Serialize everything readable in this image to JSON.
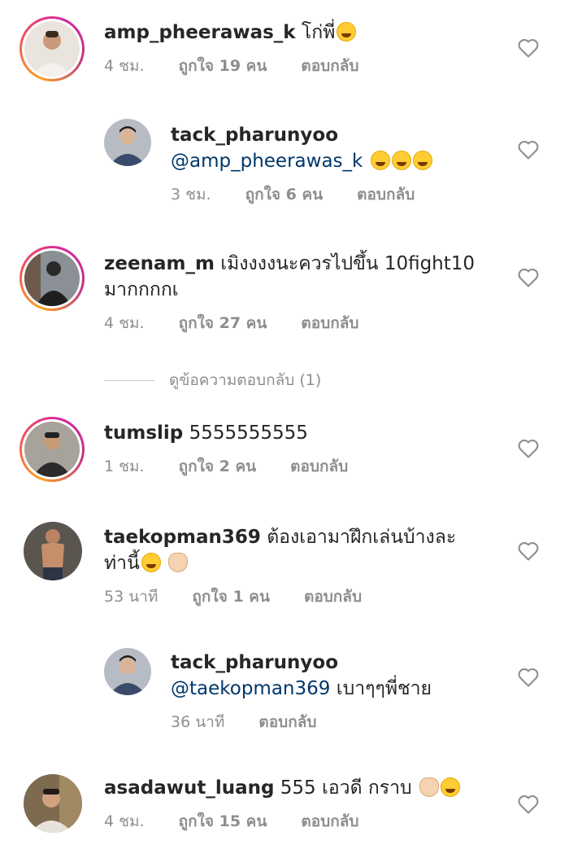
{
  "comments": [
    {
      "username": "amp_pheerawas_k",
      "text": "โก่พี่",
      "time": "4 ชม.",
      "likes": "ถูกใจ 19 คน",
      "reply": "ตอบกลับ"
    },
    {
      "username": "tack_pharunyoo",
      "mention": "@amp_pheerawas_k",
      "text": "",
      "time": "3 ชม.",
      "likes": "ถูกใจ 6 คน",
      "reply": "ตอบกลับ"
    },
    {
      "username": "zeenam_m",
      "text": "เมิงงงงนะควรไปขึ้น 10fight10",
      "text2": "มากกกกเ",
      "time": "4 ชม.",
      "likes": "ถูกใจ 27 คน",
      "reply": "ตอบกลับ"
    },
    {
      "username": "tumslip",
      "text": "5555555555",
      "time": "1 ชม.",
      "likes": "ถูกใจ 2 คน",
      "reply": "ตอบกลับ"
    },
    {
      "username": "taekopman369",
      "text": "ต้องเอามาฝึกเล่นบ้างละ",
      "text2": "ท่านี้",
      "time": "53 นาที",
      "likes": "ถูกใจ 1 คน",
      "reply": "ตอบกลับ"
    },
    {
      "username": "tack_pharunyoo",
      "mention": "@taekopman369",
      "text": "เบาๆๆพี่ชาย",
      "time": "36 นาที",
      "reply": "ตอบกลับ"
    },
    {
      "username": "asadawut_luang",
      "text": "555 เอวดี กราบ",
      "time": "4 ชม.",
      "likes": "ถูกใจ 15 คน",
      "reply": "ตอบกลับ"
    }
  ],
  "view_replies": "ดูข้อความตอบกลับ (1)",
  "colors": {
    "mention": "#00376b",
    "meta": "#8e8e8e",
    "story_ring": "#d6249f"
  },
  "icons": {
    "like": "heart-outline-icon"
  }
}
